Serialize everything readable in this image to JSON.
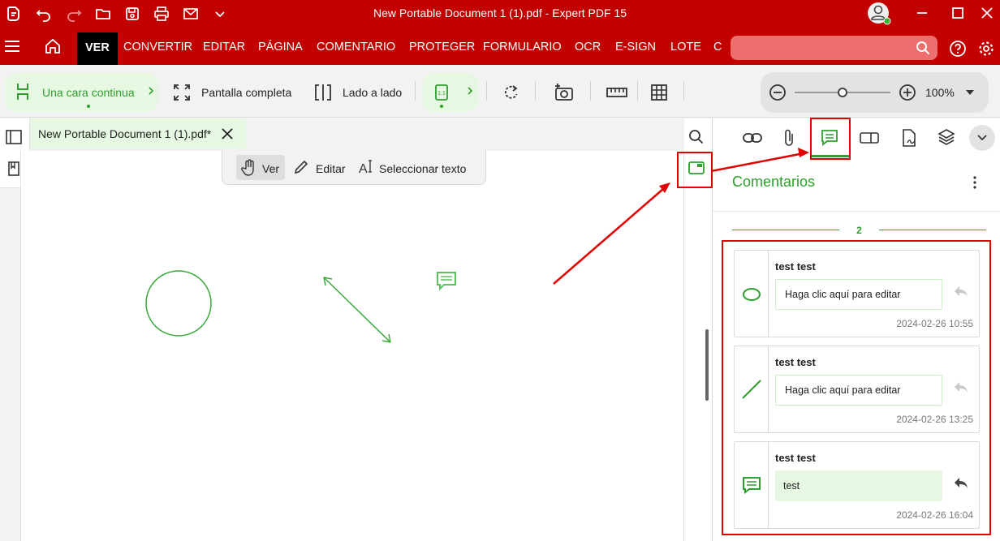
{
  "window": {
    "title": "New Portable Document 1 (1).pdf   -   Expert PDF 15"
  },
  "menu": {
    "items": [
      "VER",
      "CONVERTIR",
      "EDITAR",
      "PÁGINA",
      "COMENTARIO",
      "PROTEGER",
      "FORMULARIO",
      "OCR",
      "E-SIGN",
      "LOTE",
      "C"
    ],
    "active": "VER"
  },
  "toolbar": {
    "single_page": "Una cara continua",
    "fullscreen": "Pantalla completa",
    "side_by_side": "Lado a lado",
    "zoom_value": "100%",
    "zoom_level": 0.5
  },
  "document": {
    "tab_title": "New Portable Document 1 (1).pdf*"
  },
  "modes": {
    "view": "Ver",
    "edit": "Editar",
    "select_text": "Seleccionar texto"
  },
  "panel": {
    "title": "Comentarios",
    "page_number": "2",
    "comments": [
      {
        "author": "test test",
        "text": "Haga clic aquí para editar",
        "time": "2024-02-26 10:55",
        "type": "ellipse-icon"
      },
      {
        "author": "test test",
        "text": "Haga clic aquí para editar",
        "time": "2024-02-26 13:25",
        "type": "line-icon"
      },
      {
        "author": "test test",
        "text": "test",
        "time": "2024-02-26 16:04",
        "type": "note-icon"
      }
    ]
  },
  "colors": {
    "brand": "#c20000",
    "accent": "#2e9e2e",
    "highlight": "#e00000"
  }
}
